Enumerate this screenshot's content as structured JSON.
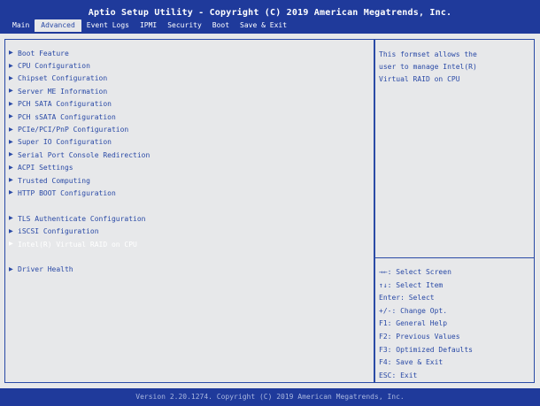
{
  "header": {
    "title": "Aptio Setup Utility - Copyright (C) 2019 American Megatrends, Inc.",
    "tabs": [
      {
        "label": "Main",
        "active": false
      },
      {
        "label": "Advanced",
        "active": true
      },
      {
        "label": "Event Logs",
        "active": false
      },
      {
        "label": "IPMI",
        "active": false
      },
      {
        "label": "Security",
        "active": false
      },
      {
        "label": "Boot",
        "active": false
      },
      {
        "label": "Save & Exit",
        "active": false
      }
    ]
  },
  "menu": {
    "items": [
      {
        "label": "Boot Feature",
        "selected": false,
        "marker": "▶"
      },
      {
        "label": "CPU Configuration",
        "selected": false,
        "marker": "▶"
      },
      {
        "label": "Chipset Configuration",
        "selected": false,
        "marker": "▶"
      },
      {
        "label": "Server ME Information",
        "selected": false,
        "marker": "▶"
      },
      {
        "label": "PCH SATA Configuration",
        "selected": false,
        "marker": "▶"
      },
      {
        "label": "PCH sSATA Configuration",
        "selected": false,
        "marker": "▶"
      },
      {
        "label": "PCIe/PCI/PnP Configuration",
        "selected": false,
        "marker": "▶"
      },
      {
        "label": "Super IO Configuration",
        "selected": false,
        "marker": "▶"
      },
      {
        "label": "Serial Port Console Redirection",
        "selected": false,
        "marker": "▶"
      },
      {
        "label": "ACPI Settings",
        "selected": false,
        "marker": "▶"
      },
      {
        "label": "Trusted Computing",
        "selected": false,
        "marker": "▶"
      },
      {
        "label": "HTTP BOOT Configuration",
        "selected": false,
        "marker": "▶"
      },
      {
        "label": "TLS Authenticate Configuration",
        "selected": false,
        "marker": "▶"
      },
      {
        "label": "iSCSI Configuration",
        "selected": false,
        "marker": "▶"
      },
      {
        "label": "Intel(R) Virtual RAID on CPU",
        "selected": true,
        "marker": "▶"
      },
      {
        "label": "Driver Health",
        "selected": false,
        "marker": "▶"
      }
    ]
  },
  "help": {
    "lines": [
      "This formset allows the",
      "user to manage Intel(R)",
      "Virtual RAID on CPU"
    ]
  },
  "keys": {
    "lines": [
      "→←: Select Screen",
      "↑↓: Select Item",
      "Enter: Select",
      "+/-: Change Opt.",
      "F1: General Help",
      "F2: Previous Values",
      "F3: Optimized Defaults",
      "F4: Save & Exit",
      "ESC: Exit"
    ]
  },
  "footer": {
    "text": "Version 2.20.1274. Copyright (C) 2019 American Megatrends, Inc."
  },
  "colors": {
    "bg": "#e7e8ea",
    "accent": "#1f3a9b",
    "text": "#2a4aa6",
    "selectedText": "#ffffff"
  },
  "icons": {
    "submenu_marker": "triangle-right-icon"
  }
}
